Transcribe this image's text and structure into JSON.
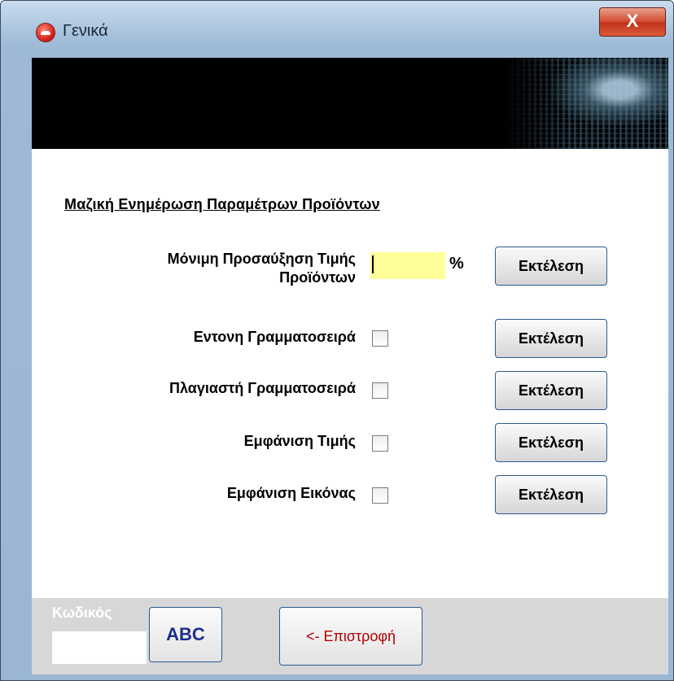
{
  "window": {
    "title": "Γενικά",
    "close_label": "X"
  },
  "section": {
    "title": "Μαζική Ενημέρωση Παραμέτρων Προϊόντων "
  },
  "rows": {
    "price_increase": {
      "label_line1": "Μόνιμη Προσαύξηση Τιμής",
      "label_line2": "Προϊόντων",
      "value": "",
      "unit": "%",
      "button": "Εκτέλεση"
    },
    "bold_font": {
      "label": "Εντονη Γραμματοσειρά",
      "checked": false,
      "button": "Εκτέλεση"
    },
    "italic_font": {
      "label": "Πλαγιαστή Γραμματοσειρά",
      "checked": false,
      "button": "Εκτέλεση"
    },
    "show_price": {
      "label": "Εμφάνιση Τιμής",
      "checked": false,
      "button": "Εκτέλεση"
    },
    "show_image": {
      "label": "Εμφάνιση Εικόνας",
      "checked": false,
      "button": "Εκτέλεση"
    }
  },
  "footer": {
    "code_label": "Κωδικός",
    "code_value": "",
    "abc_button": "ABC",
    "back_button": "<- Επιστροφή"
  },
  "colors": {
    "input_highlight": "#ffff99",
    "banner": "#000000",
    "footer": "#d7d7d7",
    "back_text": "#b00000",
    "abc_text": "#1a2f8c"
  }
}
